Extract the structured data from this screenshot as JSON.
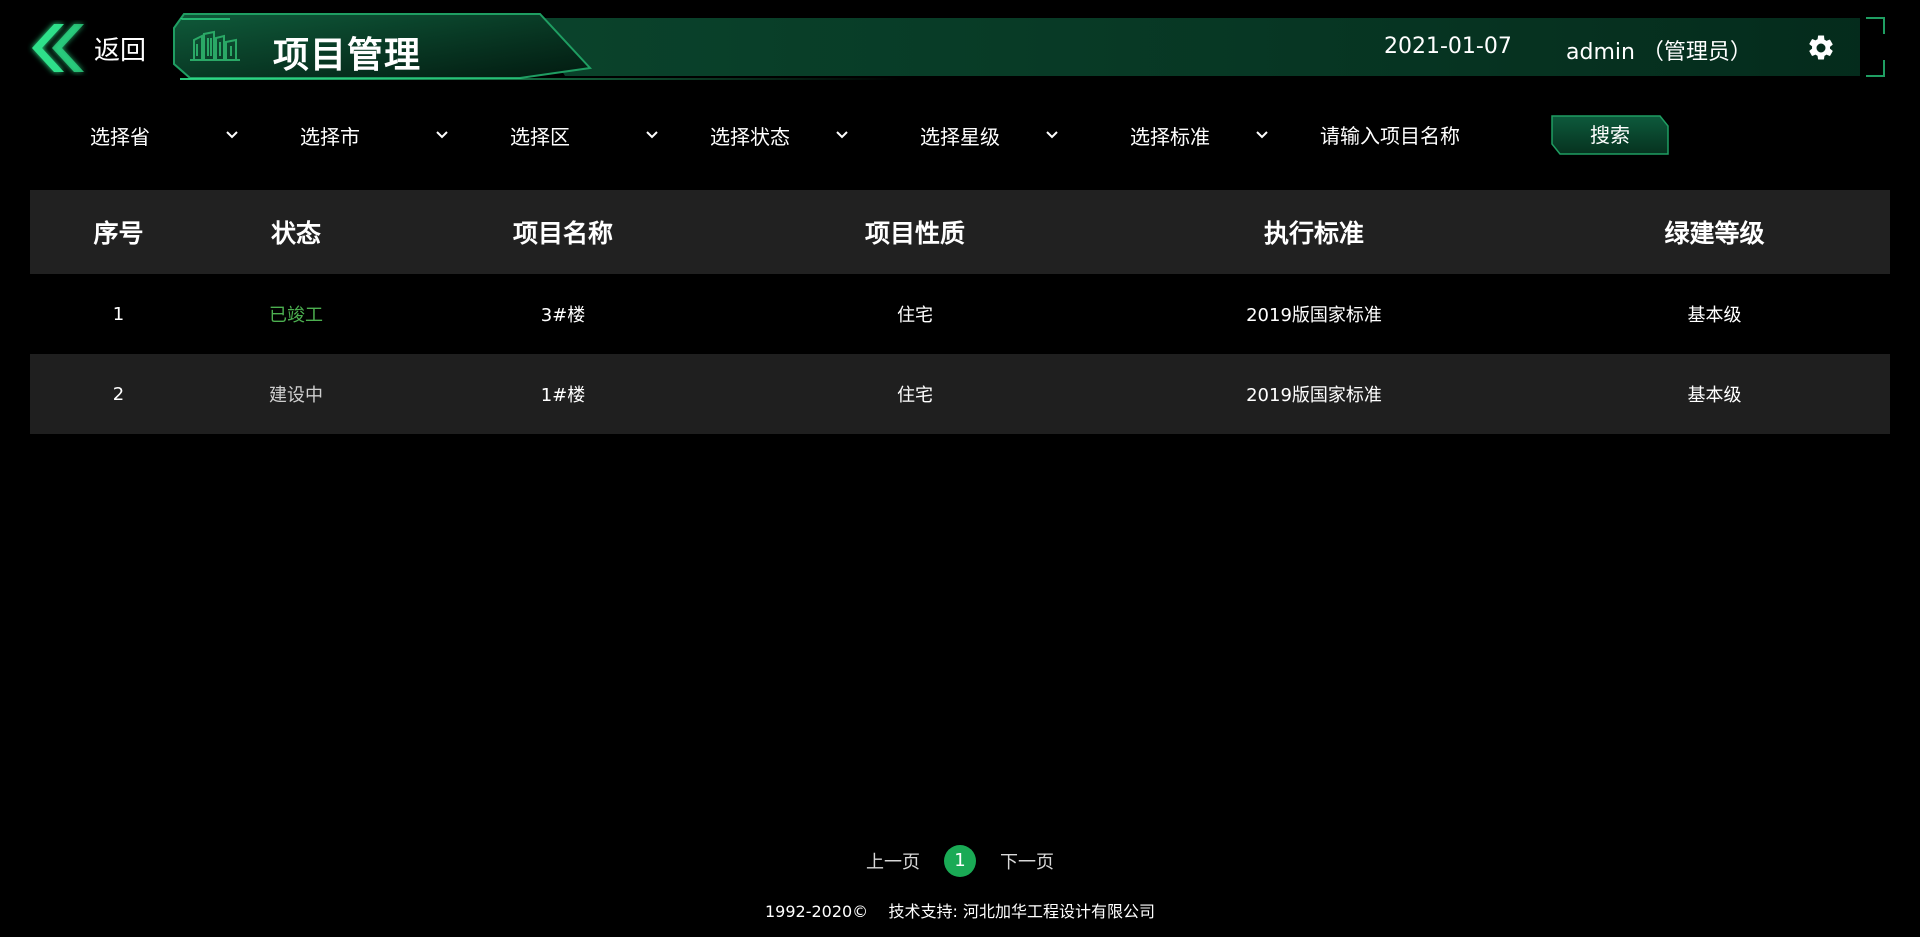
{
  "header": {
    "back_label": "返回",
    "title": "项目管理",
    "date": "2021-01-07",
    "user": "admin （管理员）"
  },
  "filters": {
    "province": "选择省",
    "city": "选择市",
    "district": "选择区",
    "status": "选择状态",
    "star": "选择星级",
    "standard": "选择标准",
    "search_placeholder": "请输入项目名称",
    "search_button": "搜索"
  },
  "table": {
    "headers": [
      "序号",
      "状态",
      "项目名称",
      "项目性质",
      "执行标准",
      "绿建等级"
    ],
    "rows": [
      [
        "1",
        "已竣工",
        "3#楼",
        "住宅",
        "2019版国家标准",
        "基本级"
      ],
      [
        "2",
        "建设中",
        "1#楼",
        "住宅",
        "2019版国家标准",
        "基本级"
      ]
    ]
  },
  "pagination": {
    "prev": "上一页",
    "current": "1",
    "next": "下一页"
  },
  "footer": {
    "copyright": "1992-2020©    技术支持: 河北加华工程设计有限公司"
  },
  "colors": {
    "accent": "#1aaa55",
    "status_done": "#4caf50",
    "header_glow": "#0d5a3a"
  },
  "icons": {
    "back": "double-chevron-left-icon",
    "title_badge": "building-icon",
    "settings": "gear-icon",
    "dropdown": "chevron-down-icon"
  }
}
